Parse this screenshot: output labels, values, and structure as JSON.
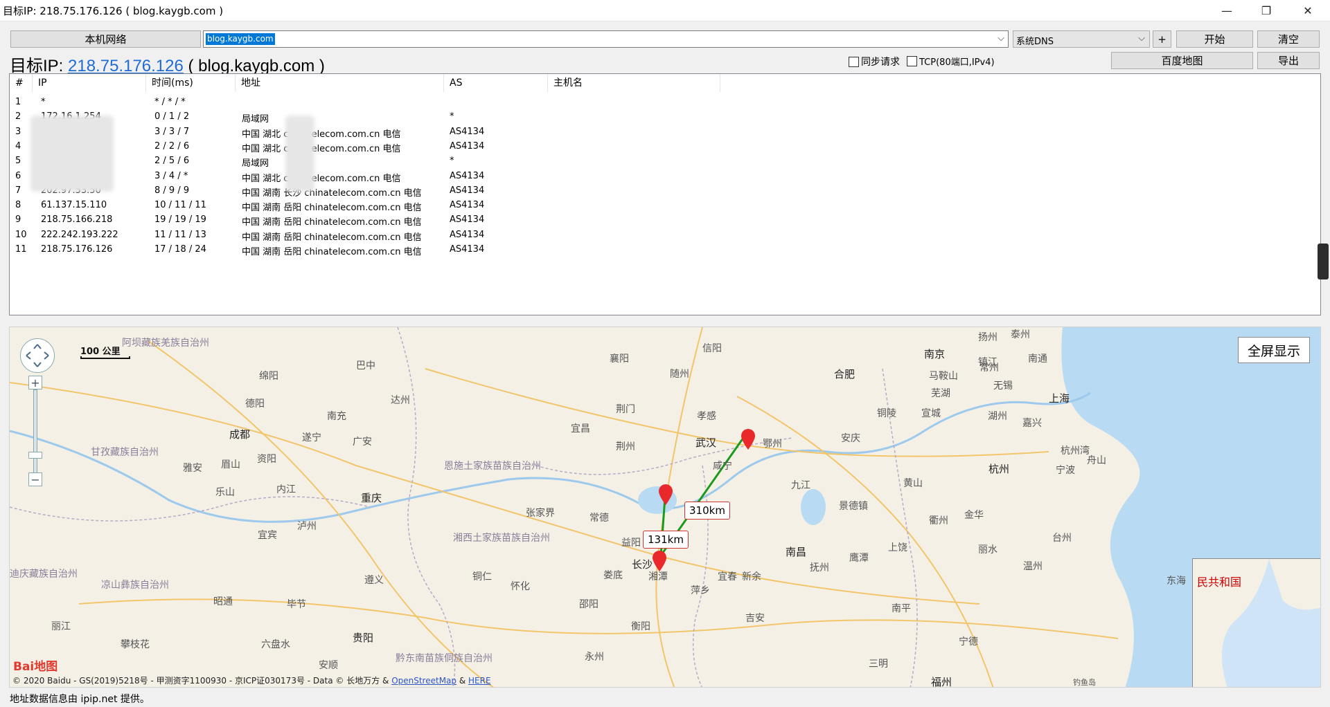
{
  "window": {
    "title": "目标IP: 218.75.176.126 ( blog.kaygb.com )",
    "minimize_glyph": "—",
    "restore_glyph": "❐",
    "close_glyph": "✕"
  },
  "toolbar": {
    "local_network_label": "本机网络",
    "host_input_value": "blog.kaygb.com",
    "dns_select_value": "系统DNS",
    "add_label": "+",
    "start_label": "开始",
    "clear_label": "清空",
    "baidu_map_label": "百度地图",
    "export_label": "导出",
    "sync_request_label": "同步请求",
    "tcp_label": "TCP(80端口,IPv4)"
  },
  "target": {
    "prefix": "目标IP: ",
    "ip": "218.75.176.126",
    "host": " ( blog.kaygb.com )"
  },
  "table": {
    "columns": [
      "#",
      "IP",
      "时间(ms)",
      "地址",
      "AS",
      "主机名"
    ],
    "rows": [
      {
        "n": "1",
        "ip": "*",
        "time": "* / * / *",
        "addr": "",
        "as": ""
      },
      {
        "n": "2",
        "ip": "172.16.1.254",
        "time": "0 / 1 / 2",
        "addr": "局域网",
        "as": "*"
      },
      {
        "n": "3",
        "ip": "",
        "time": "3 / 3 / 7",
        "addr": "中国 湖北      chinatelecom.com.cn 电信",
        "as": "AS4134"
      },
      {
        "n": "4",
        "ip": "",
        "time": "2 / 2 / 6",
        "addr": "中国 湖北      chinatelecom.com.cn 电信",
        "as": "AS4134"
      },
      {
        "n": "5",
        "ip": "",
        "time": "2 / 5 / 6",
        "addr": "局域网",
        "as": "*"
      },
      {
        "n": "6",
        "ip": "",
        "time": "3 / 4 / *",
        "addr": "中国 湖北      chinatelecom.com.cn 电信",
        "as": "AS4134"
      },
      {
        "n": "7",
        "ip": "202.97.53.50",
        "time": "8 / 9 / 9",
        "addr": "中国 湖南 长沙 chinatelecom.com.cn 电信",
        "as": "AS4134"
      },
      {
        "n": "8",
        "ip": "61.137.15.110",
        "time": "10 / 11 / 11",
        "addr": "中国 湖南 岳阳 chinatelecom.com.cn 电信",
        "as": "AS4134"
      },
      {
        "n": "9",
        "ip": "218.75.166.218",
        "time": "19 / 19 / 19",
        "addr": "中国 湖南 岳阳 chinatelecom.com.cn 电信",
        "as": "AS4134"
      },
      {
        "n": "10",
        "ip": "222.242.193.222",
        "time": "11 / 11 / 13",
        "addr": "中国 湖南 岳阳 chinatelecom.com.cn 电信",
        "as": "AS4134"
      },
      {
        "n": "11",
        "ip": "218.75.176.126",
        "time": "17 / 18 / 24",
        "addr": "中国 湖南 岳阳 chinatelecom.com.cn 电信",
        "as": "AS4134"
      }
    ]
  },
  "map": {
    "fullscreen_label": "全屏显示",
    "scale_label": "100 公里",
    "zoom_in": "+",
    "zoom_out": "−",
    "distances": [
      "310km",
      "131km"
    ],
    "minimap_label": "民共和国",
    "logo": "Bai地图",
    "copyright_prefix": "© 2020 Baidu - GS(2019)5218号 - 甲测资字1100930 - 京ICP证030173号 - Data © 长地万方 & ",
    "osm_link": "OpenStreetMap",
    "amp": " & ",
    "here_link": "HERE",
    "labels": {
      "aba": "阿坝藏族羌族自治州",
      "xinyang": "信阳",
      "nanjing": "南京",
      "yangzhou": "扬州",
      "taizhou": "泰州",
      "zhenjiang": "镇江",
      "nantong": "南通",
      "bazhong": "巴中",
      "xiangyang": "襄阳",
      "suizhou": "随州",
      "hefei": "合肥",
      "maanshan": "马鞍山",
      "changzhou": "常州",
      "mianyang": "绵阳",
      "wuhu": "芜湖",
      "wuxi": "无锡",
      "shanghai": "上海",
      "dazhou": "达州",
      "deyang": "德阳",
      "nanchong": "南充",
      "jingmen": "荆门",
      "xiaogan": "孝感",
      "tongling": "铜陵",
      "xuancheng": "宣城",
      "huzhou": "湖州",
      "jiaxing": "嘉兴",
      "chengdu": "成都",
      "suining": "遂宁",
      "guangan": "广安",
      "yichang": "宜昌",
      "wuhan": "武汉",
      "ezhou": "鄂州",
      "anqing": "安庆",
      "hangzhouwan": "杭州湾",
      "ganzi": "甘孜藏族自治州",
      "yaan": "雅安",
      "meishan": "眉山",
      "ziyang": "资阳",
      "jingzhou": "荆州",
      "enshi": "恩施土家族苗族自治州",
      "xianning": "咸宁",
      "hangzhou": "杭州",
      "ningbo": "宁波",
      "zhoushan": "舟山",
      "leshan": "乐山",
      "neijiang": "内江",
      "chongqing": "重庆",
      "jiujiang": "九江",
      "huangshan": "黄山",
      "zhangjiajie": "张家界",
      "changde": "常德",
      "jingdezhen": "景德镇",
      "quzhou": "衢州",
      "jinhua": "金华",
      "yibin": "宜宾",
      "luzhou": "泸州",
      "xiangxi": "湘西土家族苗族自治州",
      "yiyang": "益阳",
      "nanchang": "南昌",
      "yingtan": "鹰潭",
      "shangrao": "上饶",
      "lishui": "丽水",
      "taizhou_zj": "台州",
      "changsha": "长沙",
      "xiangtan": "湘潭",
      "yichun": "宜春",
      "xinyu": "新余",
      "fuzhou_jx": "抚州",
      "wenzhou": "温州",
      "liangshan": "凉山彝族自治州",
      "diqing": "迪庆藏族自治州",
      "zunyi": "遵义",
      "tongren": "铜仁",
      "huaihua": "怀化",
      "loudi": "娄底",
      "pingxiang": "萍乡",
      "donghai": "东海",
      "zhaotong": "昭通",
      "bijie": "毕节",
      "shaoyang": "邵阳",
      "jian": "吉安",
      "nanping": "南平",
      "ningde": "宁德",
      "lijiang": "丽江",
      "hengyang": "衡阳",
      "panzhihua": "攀枝花",
      "liupanshui": "六盘水",
      "guiyang": "贵阳",
      "anshun": "安顺",
      "qiandongnan": "黔东南苗族侗族自治州",
      "yongzhou": "永州",
      "sanming": "三明",
      "fuzhou": "福州",
      "diaoyu": "钓鱼岛"
    }
  },
  "status": {
    "text": "地址数据信息由 ipip.net 提供。"
  }
}
